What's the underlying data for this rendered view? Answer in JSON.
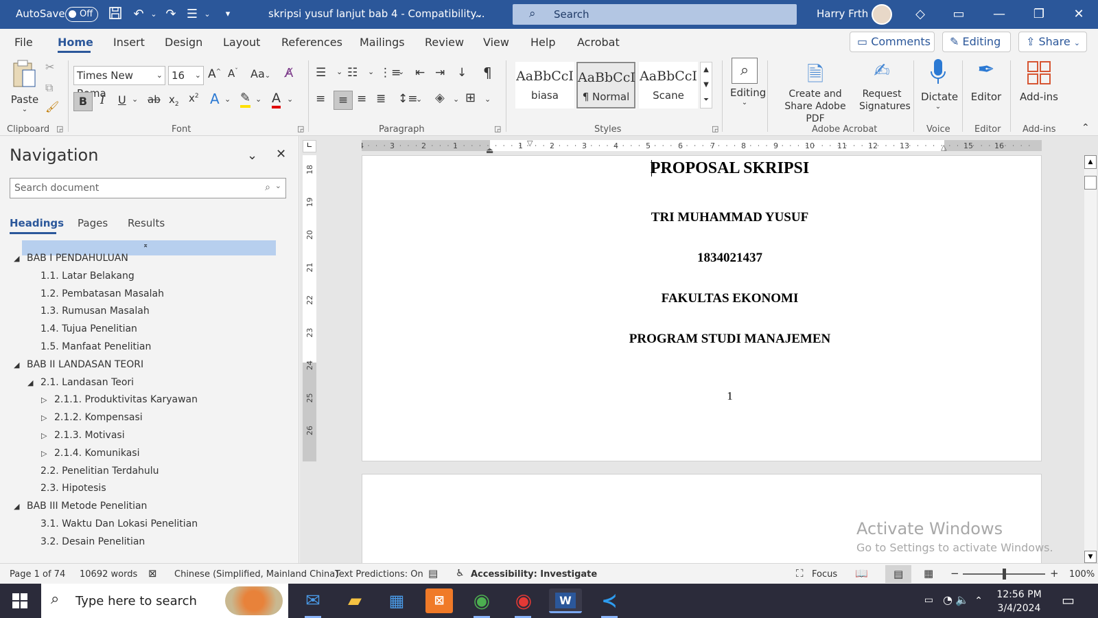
{
  "titlebar": {
    "autosave_label": "AutoSave",
    "autosave_state": "Off",
    "doc_title": "skripsi yusuf lanjut bab 4  -  Compatibility...",
    "search_placeholder": "Search",
    "user_name": "Harry Frth",
    "icons": [
      "save-icon",
      "undo-icon",
      "redo-icon",
      "list-icon",
      "customize-icon",
      "diamond-icon",
      "ribbon-display-icon",
      "minimize-icon",
      "restore-icon",
      "close-icon"
    ]
  },
  "menu": {
    "items": [
      "File",
      "Home",
      "Insert",
      "Design",
      "Layout",
      "References",
      "Mailings",
      "Review",
      "View",
      "Help",
      "Acrobat"
    ],
    "active": "Home",
    "comments_label": "Comments",
    "editing_label": "Editing",
    "share_label": "Share"
  },
  "ribbon": {
    "clipboard": {
      "paste_label": "Paste",
      "group_label": "Clipboard"
    },
    "font": {
      "font_name": "Times New Roma",
      "font_size": "16",
      "group_label": "Font",
      "case_label": "Aa"
    },
    "paragraph": {
      "group_label": "Paragraph"
    },
    "styles": {
      "cards": [
        {
          "preview": "AaBbCcI",
          "name": "biasa"
        },
        {
          "preview": "AaBbCcI",
          "name": "¶ Normal"
        },
        {
          "preview": "AaBbCcI",
          "name": "Scane"
        }
      ],
      "group_label": "Styles"
    },
    "editing": {
      "label": "Editing"
    },
    "acrobat": {
      "create_label": "Create and Share Adobe PDF",
      "request_label": "Request Signatures",
      "group_label": "Adobe Acrobat"
    },
    "voice": {
      "dictate_label": "Dictate",
      "group_label": "Voice"
    },
    "editor": {
      "label": "Editor",
      "group_label": "Editor"
    },
    "addins": {
      "label": "Add-ins",
      "group_label": "Add-ins"
    }
  },
  "navigation": {
    "title": "Navigation",
    "search_placeholder": "Search document",
    "tabs": [
      "Headings",
      "Pages",
      "Results"
    ],
    "active_tab": "Headings",
    "tree": [
      {
        "label": "BAB I  PENDAHULUAN",
        "level": 1,
        "marker": "expanded"
      },
      {
        "label": "1.1. Latar Belakang",
        "level": 2,
        "marker": "none"
      },
      {
        "label": "1.2. Pembatasan Masalah",
        "level": 2,
        "marker": "none"
      },
      {
        "label": "1.3. Rumusan Masalah",
        "level": 2,
        "marker": "none"
      },
      {
        "label": "1.4. Tujua Penelitian",
        "level": 2,
        "marker": "none"
      },
      {
        "label": "1.5. Manfaat Penelitian",
        "level": 2,
        "marker": "none"
      },
      {
        "label": "BAB II  LANDASAN TEORI",
        "level": 1,
        "marker": "expanded"
      },
      {
        "label": "2.1. Landasan Teori",
        "level": 2,
        "marker": "expanded"
      },
      {
        "label": "2.1.1. Produktivitas Karyawan",
        "level": 3,
        "marker": "collapsed"
      },
      {
        "label": "2.1.2. Kompensasi",
        "level": 3,
        "marker": "collapsed"
      },
      {
        "label": "2.1.3. Motivasi",
        "level": 3,
        "marker": "collapsed"
      },
      {
        "label": "2.1.4. Komunikasi",
        "level": 3,
        "marker": "collapsed"
      },
      {
        "label": "2.2. Penelitian Terdahulu",
        "level": 2,
        "marker": "none"
      },
      {
        "label": "2.3. Hipotesis",
        "level": 2,
        "marker": "none"
      },
      {
        "label": "BAB III   Metode Penelitian",
        "level": 1,
        "marker": "expanded"
      },
      {
        "label": "3.1. Waktu Dan Lokasi Penelitian",
        "level": 2,
        "marker": "none"
      },
      {
        "label": "3.2. Desain Penelitian",
        "level": 2,
        "marker": "none"
      }
    ]
  },
  "ruler": {
    "h_labels": [
      "4",
      "3",
      "2",
      "1",
      "1",
      "2",
      "3",
      "4",
      "5",
      "6",
      "7",
      "8",
      "9",
      "10",
      "11",
      "12",
      "13",
      "15",
      "16"
    ],
    "v_labels": [
      "18",
      "19",
      "20",
      "21",
      "22",
      "23",
      "24",
      "25",
      "26"
    ]
  },
  "document": {
    "lines": [
      "PROPOSAL SKRIPSI",
      "TRI MUHAMMAD YUSUF",
      "1834021437",
      "FAKULTAS EKONOMI",
      "PROGRAM STUDI MANAJEMEN"
    ],
    "page_number": "1",
    "watermark_title": "Activate Windows",
    "watermark_sub": "Go to Settings to activate Windows."
  },
  "status": {
    "page": "Page 1 of 74",
    "words": "10692 words",
    "language": "Chinese (Simplified, Mainland China)",
    "predictions": "Text Predictions: On",
    "accessibility": "Accessibility: Investigate",
    "focus": "Focus",
    "zoom": "100%"
  },
  "taskbar": {
    "search_placeholder": "Type here to search",
    "time": "12:56 PM",
    "date": "3/4/2024"
  },
  "colors": {
    "word_blue": "#2b579a",
    "nav_highlight": "#b7cfee"
  }
}
